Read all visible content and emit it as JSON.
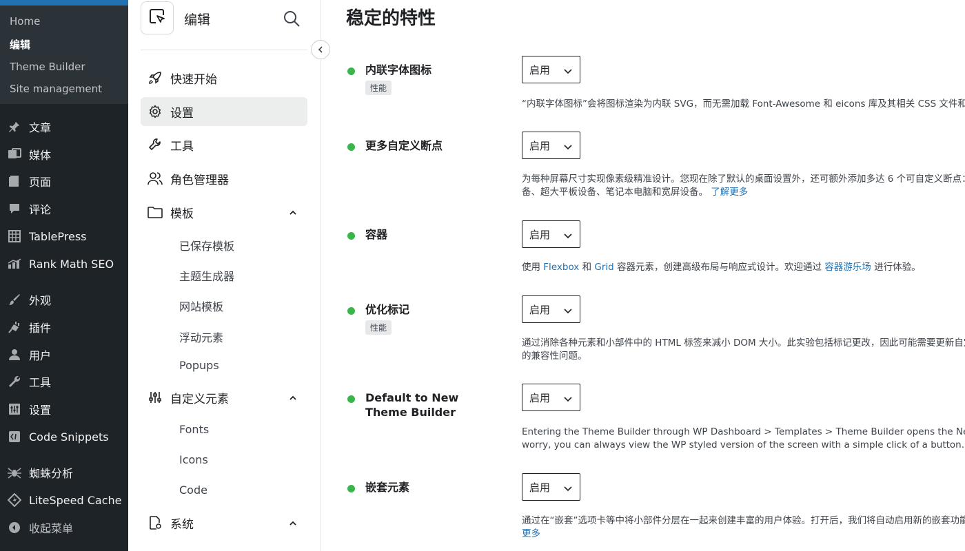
{
  "wp_sidebar": {
    "submenu": [
      {
        "label": "Home"
      },
      {
        "label": "编辑"
      },
      {
        "label": "Theme Builder"
      },
      {
        "label": "Site management"
      }
    ],
    "menu": [
      {
        "label": "文章",
        "icon": "pin-icon"
      },
      {
        "label": "媒体",
        "icon": "media-icon"
      },
      {
        "label": "页面",
        "icon": "page-icon"
      },
      {
        "label": "评论",
        "icon": "comment-icon"
      },
      {
        "label": "TablePress",
        "icon": "table-icon"
      },
      {
        "label": "Rank Math SEO",
        "icon": "chart-icon"
      },
      {
        "label": "外观",
        "icon": "brush-icon"
      },
      {
        "label": "插件",
        "icon": "plugin-icon"
      },
      {
        "label": "用户",
        "icon": "user-icon"
      },
      {
        "label": "工具",
        "icon": "wrench-icon"
      },
      {
        "label": "设置",
        "icon": "sliders-icon"
      },
      {
        "label": "Code Snippets",
        "icon": "code-icon"
      },
      {
        "label": "蜘蛛分析",
        "icon": "spider-icon"
      },
      {
        "label": "LiteSpeed Cache",
        "icon": "diamond-icon"
      },
      {
        "label": "收起菜单",
        "icon": "collapse-icon"
      }
    ]
  },
  "el_nav": {
    "title": "编辑",
    "items": [
      {
        "label": "快速开始",
        "icon": "rocket-icon"
      },
      {
        "label": "设置",
        "icon": "gear-icon"
      },
      {
        "label": "工具",
        "icon": "wrench-icon"
      },
      {
        "label": "角色管理器",
        "icon": "users-icon"
      },
      {
        "label": "模板",
        "icon": "folder-icon"
      },
      {
        "label": "自定义元素",
        "icon": "sliders-icon"
      },
      {
        "label": "系统",
        "icon": "system-icon"
      }
    ],
    "template_subitems": [
      "已保存模板",
      "主题生成器",
      "网站模板",
      "浮动元素",
      "Popups"
    ],
    "custom_subitems": [
      "Fonts",
      "Icons",
      "Code"
    ]
  },
  "main": {
    "title": "稳定的特性",
    "select_value": "启用",
    "features": [
      {
        "name": "内联字体图标",
        "tag": "性能",
        "desc1": "“内联字体图标”会将图标渲染为内联 SVG，而无需加载 Font-Awesome 和 eicons 库及其相关 CSS 文件和字体。"
      },
      {
        "name": "更多自定义断点",
        "desc1": "为每种屏幕尺寸实现像素级精准设计。您现在除了默认的桌面设置外，还可额外添加多达 6 个可自定义断点：移动设",
        "desc2": "备、超大平板设备、笔记本电脑和宽屏设备。",
        "link": "了解更多"
      },
      {
        "name": "容器",
        "desc_a": "使用 ",
        "link_flex": "Flexbox",
        "desc_b": " 和 ",
        "link_grid": "Grid",
        "desc_c": " 容器元素，创建高级布局与响应式设计。欢迎通过 ",
        "link_play": "容器游乐场",
        "desc_d": " 进行体验。"
      },
      {
        "name": "优化标记",
        "tag": "性能",
        "desc1": "通过消除各种元素和小部件中的 HTML 标签来减小 DOM 大小。此实验包括标记更改，因此可能需要更新自定义 CSS/PHP 代码",
        "desc2": "的兼容性问题。"
      },
      {
        "name": "Default to New Theme Builder",
        "desc1": "Entering the Theme Builder through WP Dashboard > Templates > Theme Builder opens the New theme builder by default. But don't",
        "desc2": "worry, you can always view the WP styled version of the screen with a simple click of a button."
      },
      {
        "name": "嵌套元素",
        "desc1": "通过在“嵌套”选项卡等中将小部件分层在一起来创建丰富的用户体验。打开后，我们将自动启用新的嵌套功能。",
        "link": "更多"
      }
    ]
  }
}
